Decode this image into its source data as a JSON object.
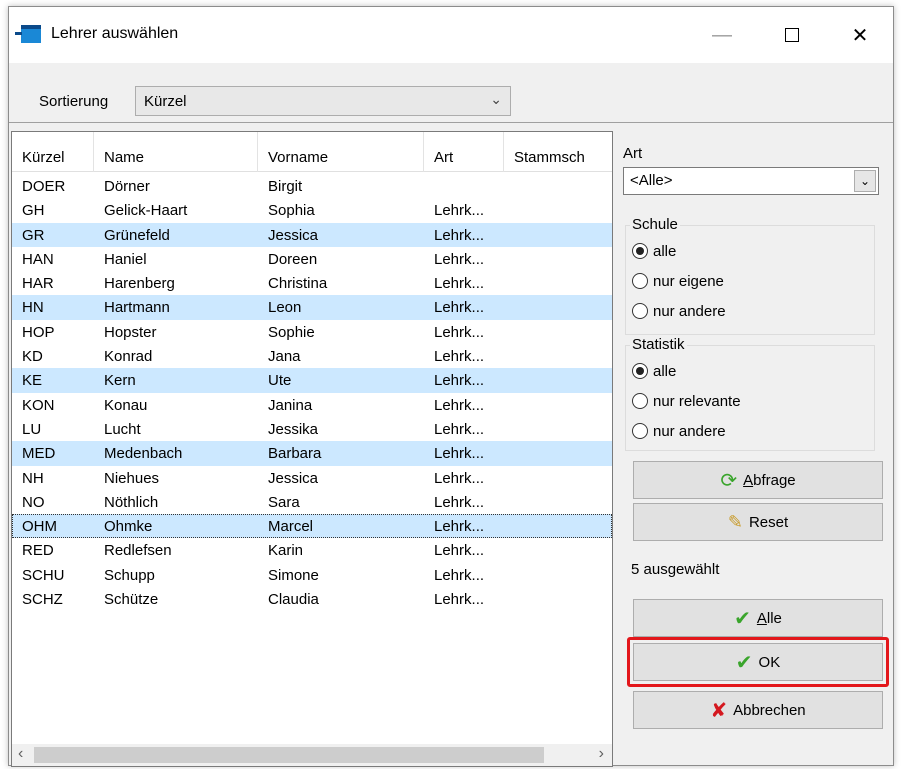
{
  "window": {
    "title": "Lehrer auswählen",
    "controls": {
      "minimize": "—",
      "close": "✕"
    }
  },
  "sort": {
    "label": "Sortierung",
    "value": "Kürzel"
  },
  "list": {
    "columns": [
      "Kürzel",
      "Name",
      "Vorname",
      "Art",
      "Stammsch"
    ],
    "rows": [
      {
        "kuerzel": "DOER",
        "name": "Dörner",
        "vorname": "Birgit",
        "art": "",
        "selected": false
      },
      {
        "kuerzel": "GH",
        "name": "Gelick-Haart",
        "vorname": "Sophia",
        "art": "Lehrk...",
        "selected": false
      },
      {
        "kuerzel": "GR",
        "name": "Grünefeld",
        "vorname": "Jessica",
        "art": "Lehrk...",
        "selected": true
      },
      {
        "kuerzel": "HAN",
        "name": "Haniel",
        "vorname": "Doreen",
        "art": "Lehrk...",
        "selected": false
      },
      {
        "kuerzel": "HAR",
        "name": "Harenberg",
        "vorname": "Christina",
        "art": "Lehrk...",
        "selected": false
      },
      {
        "kuerzel": "HN",
        "name": "Hartmann",
        "vorname": "Leon",
        "art": "Lehrk...",
        "selected": true
      },
      {
        "kuerzel": "HOP",
        "name": "Hopster",
        "vorname": "Sophie",
        "art": "Lehrk...",
        "selected": false
      },
      {
        "kuerzel": "KD",
        "name": "Konrad",
        "vorname": "Jana",
        "art": "Lehrk...",
        "selected": false
      },
      {
        "kuerzel": "KE",
        "name": "Kern",
        "vorname": "Ute",
        "art": "Lehrk...",
        "selected": true
      },
      {
        "kuerzel": "KON",
        "name": "Konau",
        "vorname": "Janina",
        "art": "Lehrk...",
        "selected": false
      },
      {
        "kuerzel": "LU",
        "name": "Lucht",
        "vorname": "Jessika",
        "art": "Lehrk...",
        "selected": false
      },
      {
        "kuerzel": "MED",
        "name": "Medenbach",
        "vorname": "Barbara",
        "art": "Lehrk...",
        "selected": true
      },
      {
        "kuerzel": "NH",
        "name": "Niehues",
        "vorname": "Jessica",
        "art": "Lehrk...",
        "selected": false
      },
      {
        "kuerzel": "NO",
        "name": "Nöthlich",
        "vorname": "Sara",
        "art": "Lehrk...",
        "selected": false
      },
      {
        "kuerzel": "OHM",
        "name": "Ohmke",
        "vorname": "Marcel",
        "art": "Lehrk...",
        "selected": true,
        "focused": true
      },
      {
        "kuerzel": "RED",
        "name": "Redlefsen",
        "vorname": "Karin",
        "art": "Lehrk...",
        "selected": false
      },
      {
        "kuerzel": "SCHU",
        "name": "Schupp",
        "vorname": "Simone",
        "art": "Lehrk...",
        "selected": false
      },
      {
        "kuerzel": "SCHZ",
        "name": "Schütze",
        "vorname": "Claudia",
        "art": "Lehrk...",
        "selected": false
      }
    ],
    "selection_color": "#cce8ff"
  },
  "filter": {
    "art_label": "Art",
    "art_value": "<Alle>",
    "schule": {
      "title": "Schule",
      "options": [
        "alle",
        "nur eigene",
        "nur andere"
      ],
      "selected": "alle"
    },
    "statistik": {
      "title": "Statistik",
      "options": [
        "alle",
        "nur relevante",
        "nur andere"
      ],
      "selected": "alle"
    }
  },
  "buttons": {
    "abfrage_first": "A",
    "abfrage_rest": "bfrage",
    "reset": "Reset",
    "alle_first": "A",
    "alle_rest": "lle",
    "ok": "OK",
    "abbrechen": "Abbrechen"
  },
  "status": {
    "count_text": "5 ausgewählt"
  },
  "colors": {
    "highlight": "#e3171b",
    "check_green": "#3aa52c",
    "cancel_red": "#d4181f"
  }
}
